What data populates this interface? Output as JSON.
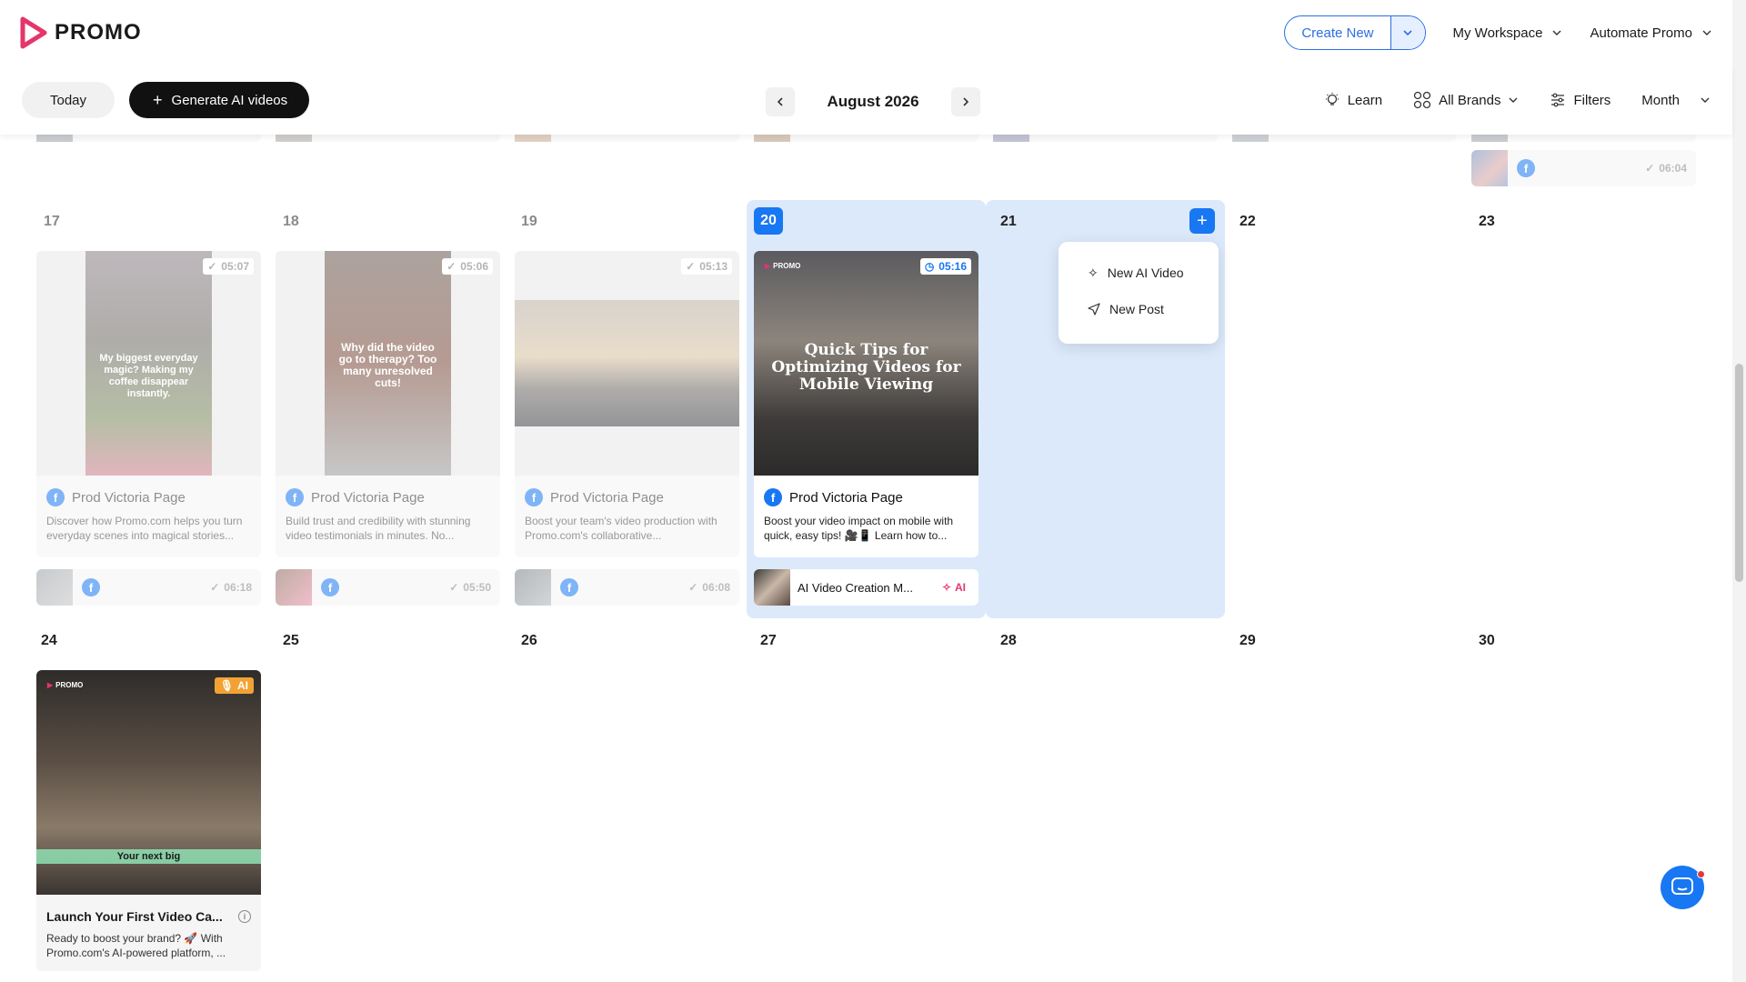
{
  "header": {
    "logo_text": "PROMO",
    "create_new": "Create New",
    "workspace": "My Workspace",
    "automate": "Automate Promo"
  },
  "toolbar": {
    "today": "Today",
    "generate": "Generate AI videos",
    "month": "August 2026",
    "learn": "Learn",
    "brands": "All Brands",
    "filters": "Filters",
    "view": "Month"
  },
  "colors": {
    "accent": "#1877f2",
    "highlight": "#dbe9fb",
    "ai_pink": "#e5356b",
    "ai_orange": "#f2a234"
  },
  "prev_week_mini": {
    "page_icon": "facebook-icon",
    "time": "06:04"
  },
  "week3": {
    "days": [
      "17",
      "18",
      "19",
      "20",
      "21",
      "22",
      "23"
    ],
    "posts": [
      {
        "time": "05:07",
        "page": "Prod Victoria Page",
        "desc": "Discover how Promo.com helps you turn everyday scenes into magical stories...",
        "caption": "My biggest everyday magic? Making my coffee disappear instantly."
      },
      {
        "time": "05:06",
        "page": "Prod Victoria Page",
        "desc": "Build trust and credibility with stunning video testimonials in minutes. No...",
        "caption": "Why did the video go to therapy? Too many unresolved cuts!"
      },
      {
        "time": "05:13",
        "page": "Prod Victoria Page",
        "desc": "Boost your team's video production with Promo.com's collaborative...",
        "caption": ""
      },
      {
        "time": "05:16",
        "page": "Prod Victoria Page",
        "desc": "Boost your video impact on mobile with quick, easy tips! 🎥📱 Learn how to...",
        "caption": "Quick Tips for Optimizing Videos for Mobile Viewing"
      }
    ],
    "minis": [
      {
        "time": "06:18"
      },
      {
        "time": "05:50"
      },
      {
        "time": "06:08"
      }
    ],
    "ai_mini": {
      "title": "AI Video Creation M...",
      "tag": "AI"
    }
  },
  "popover": {
    "items": [
      "New AI Video",
      "New Post"
    ]
  },
  "week4": {
    "days": [
      "24",
      "25",
      "26",
      "27",
      "28",
      "29",
      "30"
    ],
    "ai_card": {
      "badge": "AI",
      "caption": "Your next big",
      "title": "Launch Your First Video Ca...",
      "desc": "Ready to boost your brand? 🚀 With Promo.com's AI-powered platform, ..."
    }
  }
}
